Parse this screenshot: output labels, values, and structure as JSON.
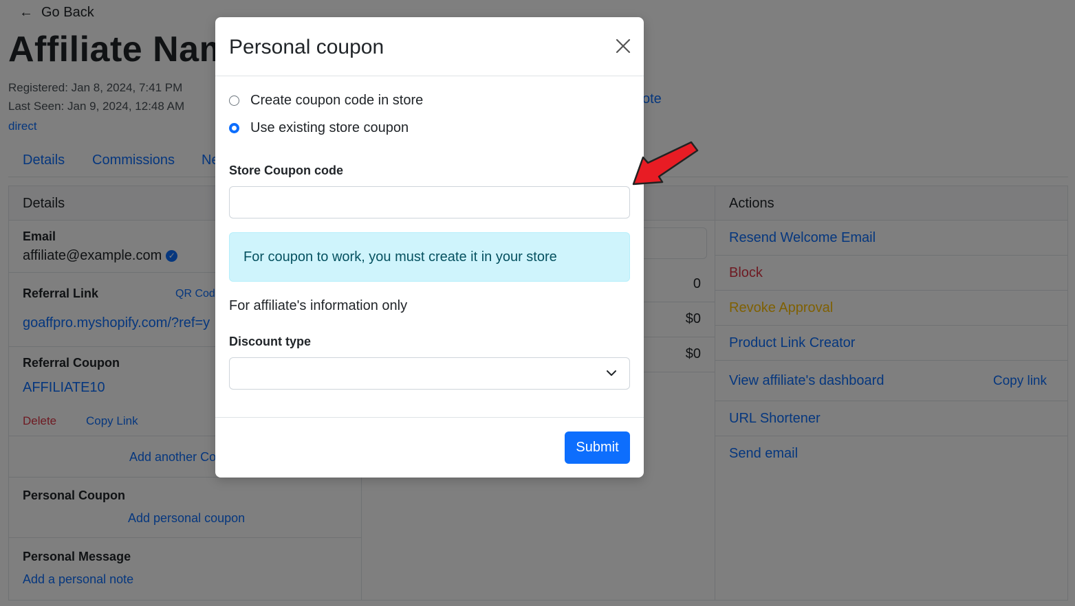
{
  "page": {
    "go_back": "Go Back",
    "affiliate_name": "Affiliate Name",
    "registered": "Registered: Jan 8, 2024, 7:41 PM",
    "last_seen": "Last Seen: Jan 9, 2024, 12:48 AM",
    "source": "direct",
    "note_link": "ote",
    "tabs": [
      "Details",
      "Commissions",
      "Ne"
    ]
  },
  "details": {
    "header": "Details",
    "email_label": "Email",
    "email_value": "affiliate@example.com",
    "referral_link_label": "Referral Link",
    "qr_code": "QR Code",
    "referral_link_value": "goaffpro.myshopify.com/?ref=y",
    "referral_coupon_label": "Referral Coupon",
    "referral_coupon_value": "AFFILIATE10",
    "delete": "Delete",
    "copy_link": "Copy Link",
    "add_another_coupon": "Add another Co",
    "personal_coupon_label": "Personal Coupon",
    "add_personal_coupon": "Add personal coupon",
    "personal_message_label": "Personal Message",
    "add_personal_note": "Add a personal note"
  },
  "stats": {
    "values": [
      "0",
      "$0",
      "$0"
    ]
  },
  "actions": {
    "header": "Actions",
    "resend_welcome": "Resend Welcome Email",
    "block": "Block",
    "revoke_approval": "Revoke Approval",
    "product_link_creator": "Product Link Creator",
    "view_dashboard": "View affiliate's dashboard",
    "copy_link": "Copy link",
    "url_shortener": "URL Shortener",
    "send_email": "Send email"
  },
  "modal": {
    "title": "Personal coupon",
    "radio_create": "Create coupon code in store",
    "radio_existing": "Use existing store coupon",
    "selected_option": "existing",
    "store_coupon_label": "Store Coupon code",
    "store_coupon_value": "",
    "alert_text": "For coupon to work, you must create it in your store",
    "info_text": "For affiliate's information only",
    "discount_type_label": "Discount type",
    "discount_type_value": "",
    "submit": "Submit"
  },
  "colors": {
    "primary": "#0d6efd",
    "danger": "#dc3545",
    "warning": "#ffc107",
    "info_bg": "#cff4fc",
    "info_text": "#055160",
    "arrow": "#e81c24"
  }
}
